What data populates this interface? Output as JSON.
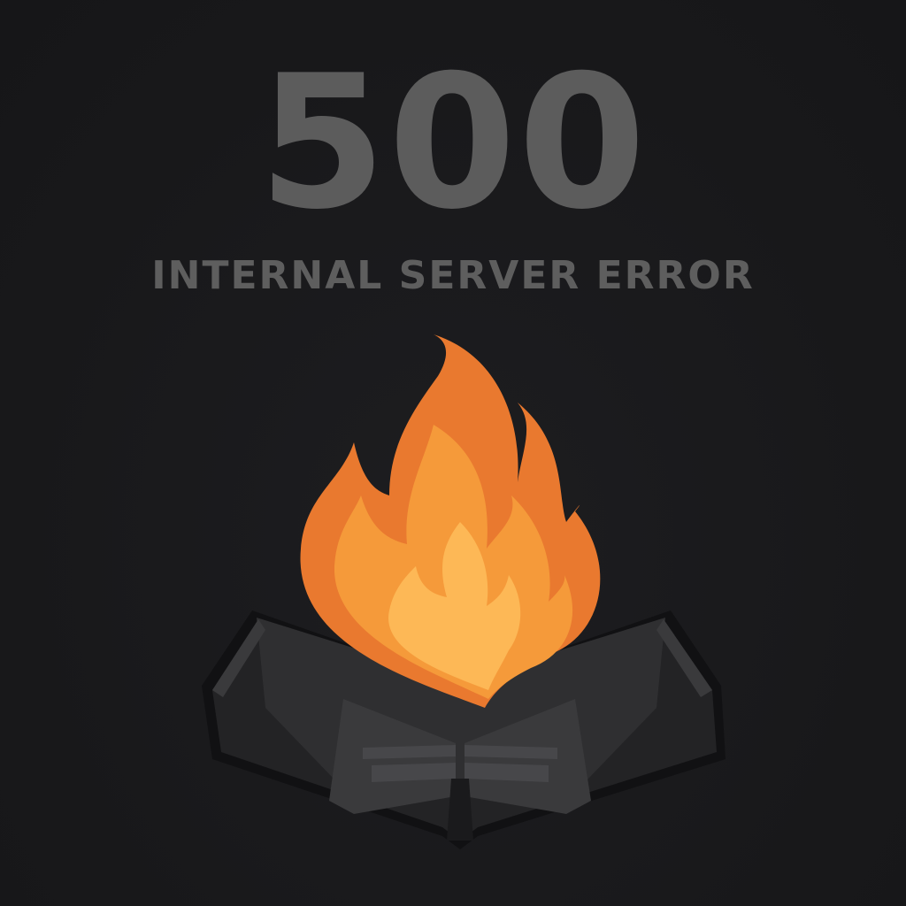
{
  "error": {
    "code": "500",
    "message": "INTERNAL SERVER ERROR"
  },
  "illustration": {
    "icon": "burning-book-icon",
    "colors": {
      "flame_outer": "#e9792f",
      "flame_middle": "#f59a3a",
      "flame_inner": "#fdb856",
      "book": "#2c2c2e",
      "book_pages": "#404042",
      "text": "#5c5c5c",
      "background": "#19191b"
    }
  }
}
